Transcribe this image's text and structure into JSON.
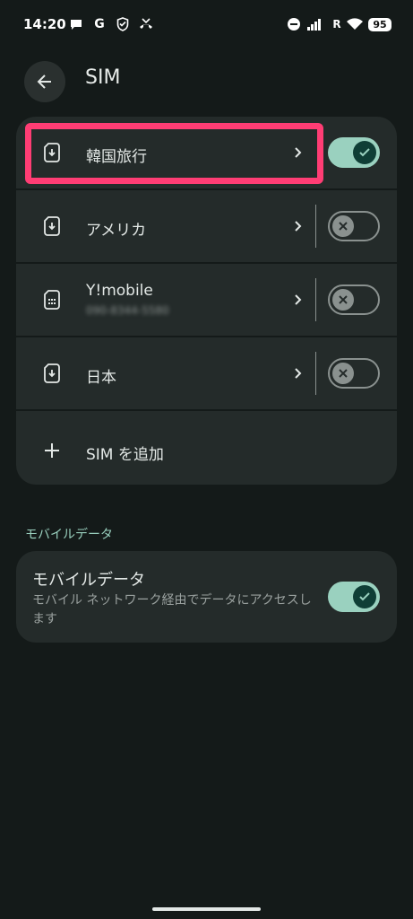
{
  "status_bar": {
    "time": "14:20",
    "battery": "95",
    "network_label": "R"
  },
  "header": {
    "title": "SIM"
  },
  "sims": [
    {
      "name": "韓国旅行",
      "subtitle": "",
      "enabled": true
    },
    {
      "name": "アメリカ",
      "subtitle": "",
      "enabled": false
    },
    {
      "name": "Y!mobile",
      "subtitle": "090-8344-5580",
      "enabled": false
    },
    {
      "name": "日本",
      "subtitle": "",
      "enabled": false
    }
  ],
  "add_sim": {
    "label": "SIM を追加"
  },
  "mobile_data_section": {
    "header": "モバイルデータ",
    "title": "モバイルデータ",
    "description": "モバイル ネットワーク経由でデータにアクセスします",
    "enabled": true
  },
  "colors": {
    "accent": "#9ad1bf",
    "highlight": "#ff3d74",
    "card": "#242b2a",
    "background": "#141a19"
  }
}
